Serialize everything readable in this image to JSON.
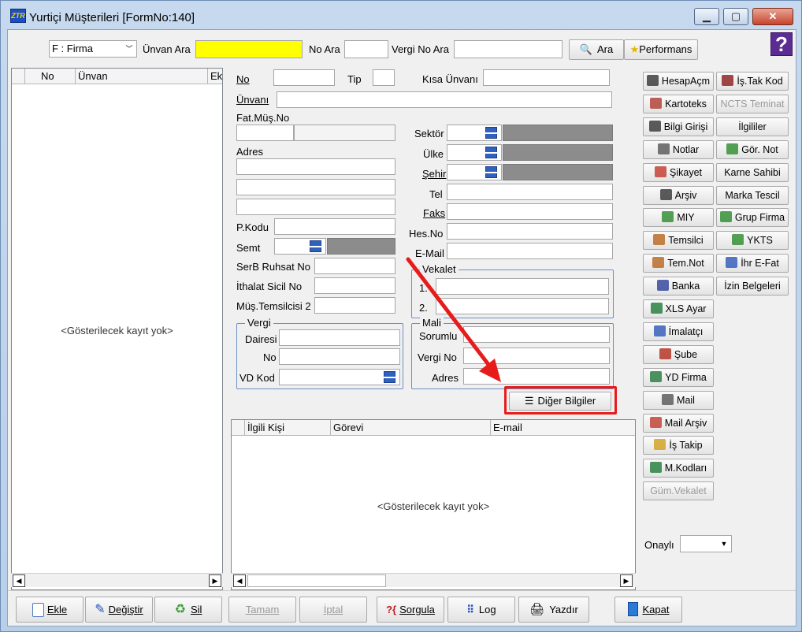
{
  "window": {
    "title": "Yurtiçi Müşterileri [FormNo:140]",
    "app_icon_text": "ZTR",
    "help_symbol": "?"
  },
  "toolbar": {
    "filter_select": "F : Firma",
    "unvan_ara_label": "Ünvan Ara",
    "no_ara_label": "No Ara",
    "vergi_no_ara_label": "Vergi No Ara",
    "ara_label": "Ara",
    "performans_label": "Performans"
  },
  "left_grid": {
    "columns": [
      "No",
      "Ünvan",
      "Ek"
    ],
    "empty_text": "<Gösterilecek kayıt yok>"
  },
  "form": {
    "no_label": "No",
    "tip_label": "Tip",
    "kisa_unvan_label": "Kısa Ünvanı",
    "unvan_label": "Ünvanı",
    "fat_mus_no_label": "Fat.Müş.No",
    "adres_label": "Adres",
    "sektor_label": "Sektör",
    "ulke_label": "Ülke",
    "sehir_label": "Şehir",
    "tel_label": "Tel",
    "faks_label": "Faks",
    "hesno_label": "Hes.No",
    "email_label": "E-Mail",
    "pkodu_label": "P.Kodu",
    "semt_label": "Semt",
    "serb_label": "SerB Ruhsat No",
    "ithalat_label": "İthalat Sicil No",
    "mus_temsilci_label": "Müş.Temsilcisi 2",
    "vekalet_title": "Vekalet",
    "vekalet_1": "1.",
    "vekalet_2": "2.",
    "vergi_title": "Vergi",
    "dairesi_label": "Dairesi",
    "vergi_no_label": "No",
    "vd_kod_label": "VD Kod",
    "mali_title": "Mali",
    "sorumlu_label": "Sorumlu",
    "mali_vergi_no_label": "Vergi No",
    "mali_adres_label": "Adres",
    "diger_bilgiler_label": "Diğer Bilgiler"
  },
  "contact_grid": {
    "columns": [
      "İlgili Kişi",
      "Görevi",
      "E-mail"
    ],
    "empty_text": "<Gösterilecek kayıt yok>"
  },
  "side_buttons_left": [
    "HesapAçm",
    "Kartoteks",
    "Bilgi Girişi",
    "Notlar",
    "Şikayet",
    "Arşiv",
    "MIY",
    "Temsilci",
    "Tem.Not",
    "Banka",
    "XLS Ayar",
    "İmalatçı",
    "Şube",
    "YD Firma",
    "Mail",
    "Mail Arşiv",
    "İş Takip",
    "M.Kodları",
    "Güm.Vekalet"
  ],
  "side_buttons_right": [
    "İş.Tak Kod",
    "NCTS Teminat",
    "İlgililer",
    "Gör. Not",
    "Karne Sahibi",
    "Marka Tescil",
    "Grup Firma",
    "YKTS",
    "İhr E-Fat",
    "İzin Belgeleri"
  ],
  "onayli": {
    "label": "Onaylı",
    "value": ""
  },
  "bottom": {
    "ekle": "Ekle",
    "degistir": "Değiştir",
    "sil": "Sil",
    "tamam": "Tamam",
    "iptal": "İptal",
    "sorgula": "Sorgula",
    "log": "Log",
    "yazdir": "Yazdır",
    "kapat": "Kapat"
  },
  "colors": {
    "highlight": "#e81b1b",
    "search_bg": "#ffff00",
    "lookup_btn": "#2f61c1"
  }
}
